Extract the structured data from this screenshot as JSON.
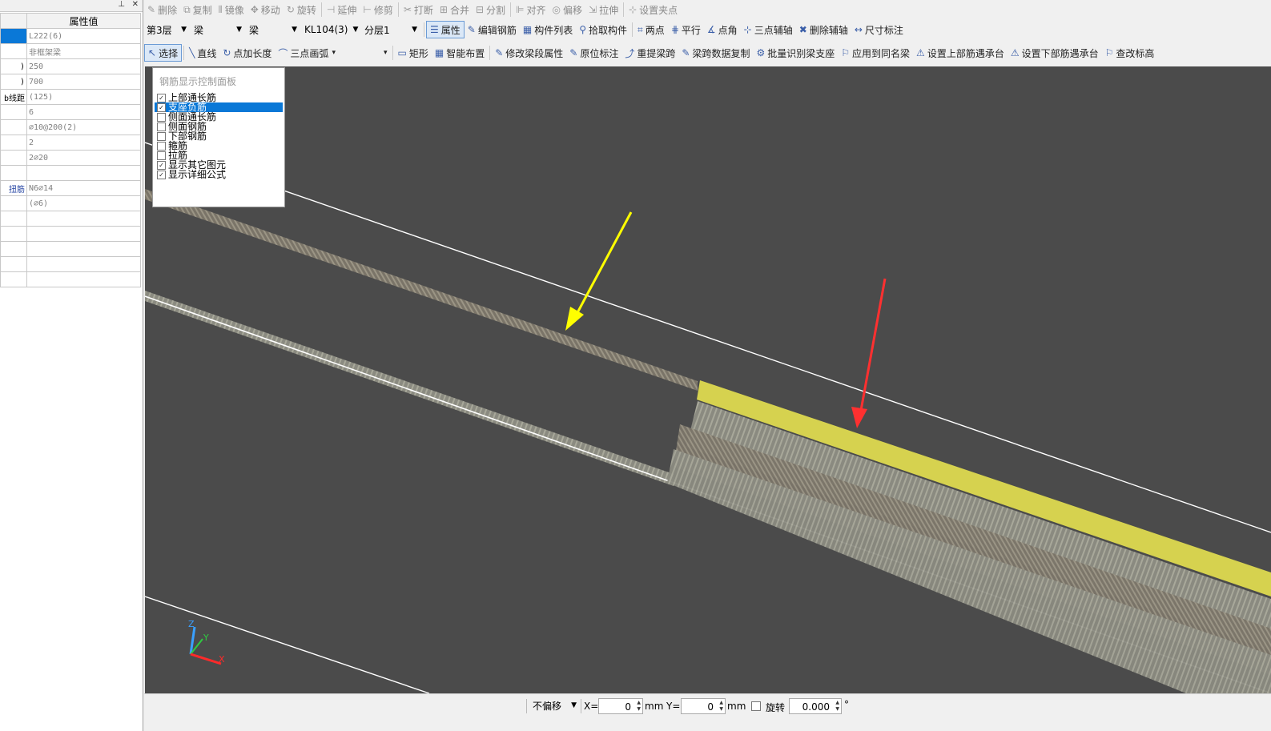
{
  "left_panel": {
    "header": "属性值",
    "rows": [
      {
        "name": "",
        "value": "L222(6)"
      },
      {
        "name": "",
        "value": "非框架梁"
      },
      {
        "name": ")",
        "value": "250"
      },
      {
        "name": ")",
        "value": "700"
      },
      {
        "name": "b线距",
        "value": "(125)"
      },
      {
        "name": "",
        "value": "6"
      },
      {
        "name": "",
        "value": "⌀10@200(2)"
      },
      {
        "name": "",
        "value": "2"
      },
      {
        "name": "",
        "value": "2⌀20"
      },
      {
        "name": "",
        "value": ""
      },
      {
        "name": "扭筋",
        "value": "N6⌀14"
      },
      {
        "name": "",
        "value": "(⌀6)"
      },
      {
        "name": "",
        "value": ""
      },
      {
        "name": "",
        "value": ""
      },
      {
        "name": "",
        "value": ""
      },
      {
        "name": "",
        "value": ""
      },
      {
        "name": "",
        "value": ""
      }
    ]
  },
  "toolbar1": [
    "删除",
    "复制",
    "镜像",
    "移动",
    "旋转",
    "延伸",
    "修剪",
    "打断",
    "合并",
    "分割",
    "对齐",
    "偏移",
    "拉伸",
    "设置夹点"
  ],
  "toolbar2": {
    "floor": "第3层",
    "type1": "梁",
    "type2": "梁",
    "member": "KL104(3)",
    "layer": "分层1",
    "buttons": [
      "属性",
      "编辑钢筋",
      "构件列表",
      "拾取构件",
      "两点",
      "平行",
      "点角",
      "三点辅轴",
      "删除辅轴",
      "尺寸标注"
    ]
  },
  "toolbar3": [
    "选择",
    "直线",
    "点加长度",
    "三点画弧",
    "矩形",
    "智能布置",
    "修改梁段属性",
    "原位标注",
    "重提梁跨",
    "梁跨数据复制",
    "批量识别梁支座",
    "应用到同名梁",
    "设置上部筋遇承台",
    "设置下部筋遇承台",
    "查改标高"
  ],
  "rebar_panel": {
    "title": "钢筋显示控制面板",
    "items": [
      {
        "label": "上部通长筋",
        "checked": true,
        "selected": false
      },
      {
        "label": "支座负筋",
        "checked": true,
        "selected": true
      },
      {
        "label": "侧面通长筋",
        "checked": false,
        "selected": false
      },
      {
        "label": "侧面钢筋",
        "checked": false,
        "selected": false
      },
      {
        "label": "下部钢筋",
        "checked": false,
        "selected": false
      },
      {
        "label": "箍筋",
        "checked": false,
        "selected": false
      },
      {
        "label": "拉筋",
        "checked": false,
        "selected": false
      },
      {
        "label": "显示其它图元",
        "checked": true,
        "selected": false
      },
      {
        "label": "显示详细公式",
        "checked": true,
        "selected": false
      }
    ]
  },
  "statusbar": {
    "offset": "不偏移",
    "x_label": "X=",
    "x_value": "0",
    "y_label": "Y=",
    "y_value": "0",
    "unit": "mm",
    "rotate_label": "旋转",
    "rotate_value": "0.000",
    "degree": "°"
  },
  "axes": {
    "z": "Z",
    "y": "Y",
    "x": "X",
    "colors": {
      "z": "#3aa0ff",
      "y": "#2ecc40",
      "x": "#ff2a2a"
    }
  },
  "colors": {
    "highlight_bar": "#d6d24f",
    "yellow_arrow": "#ffff00",
    "red_arrow": "#ff3030",
    "canvas": "#4b4b4b"
  }
}
